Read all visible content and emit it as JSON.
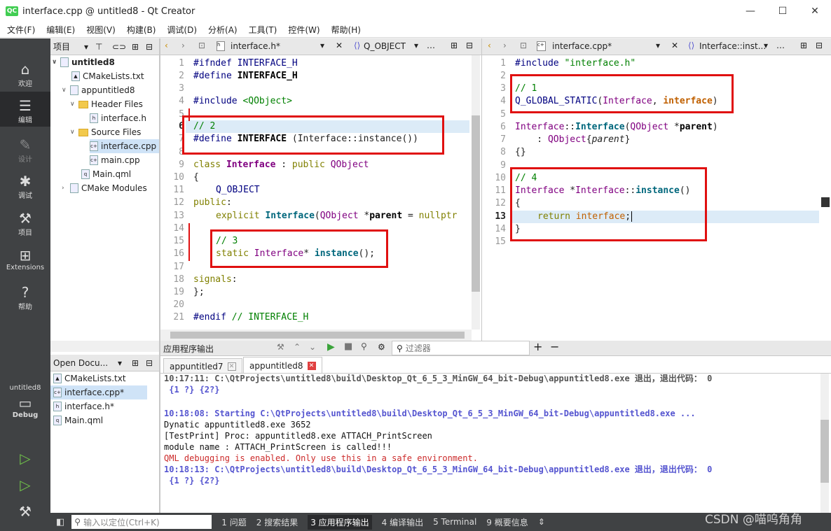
{
  "window": {
    "title": "interface.cpp @ untitled8 - Qt Creator",
    "app_icon": "QC",
    "minimize": "—",
    "maximize": "☐",
    "close": "✕"
  },
  "menu": [
    "文件(F)",
    "编辑(E)",
    "视图(V)",
    "构建(B)",
    "调试(D)",
    "分析(A)",
    "工具(T)",
    "控件(W)",
    "帮助(H)"
  ],
  "modes": [
    {
      "label": "欢迎",
      "icon": "home-icon"
    },
    {
      "label": "编辑",
      "icon": "edit-icon"
    },
    {
      "label": "设计",
      "icon": "design-icon"
    },
    {
      "label": "调试",
      "icon": "bug-icon"
    },
    {
      "label": "项目",
      "icon": "wrench-icon"
    },
    {
      "label": "Extensions",
      "icon": "extensions-icon"
    },
    {
      "label": "帮助",
      "icon": "help-icon"
    }
  ],
  "kit": {
    "project": "untitled8",
    "label": "Debug"
  },
  "project_panel": {
    "title": "项目",
    "tree": [
      "untitled8",
      "CMakeLists.txt",
      "appuntitled8",
      "Header Files",
      "interface.h",
      "Source Files",
      "interface.cpp",
      "main.cpp",
      "Main.qml",
      "CMake Modules"
    ]
  },
  "open_docs": {
    "title": "Open Docu...",
    "items": [
      "CMakeLists.txt",
      "interface.cpp*",
      "interface.h*",
      "Main.qml"
    ]
  },
  "left_editor": {
    "file": "interface.h*",
    "symbol": "Q_OBJECT",
    "lines": [
      "1",
      "2",
      "3",
      "4",
      "5",
      "6",
      "7",
      "8",
      "9",
      "10",
      "11",
      "12",
      "13",
      "14",
      "15",
      "16",
      "17",
      "18",
      "19",
      "20",
      "21"
    ]
  },
  "right_editor": {
    "file": "interface.cpp*",
    "symbol": "Interface::inst...",
    "lines": [
      "1",
      "2",
      "3",
      "4",
      "5",
      "6",
      "7",
      "8",
      "9",
      "10",
      "11",
      "12",
      "13",
      "14",
      "15"
    ]
  },
  "output": {
    "title": "应用程序输出",
    "filter_placeholder": "过滤器",
    "tabs": [
      "appuntitled7",
      "appuntitled8"
    ],
    "lines": [
      "10:17:11: C:\\QtProjects\\untitled8\\build\\Desktop_Qt_6_5_3_MinGW_64_bit-Debug\\appuntitled8.exe 退出，退出代码： 0",
      " {1 ?} {2?}",
      "",
      "10:18:08: Starting C:\\QtProjects\\untitled8\\build\\Desktop_Qt_6_5_3_MinGW_64_bit-Debug\\appuntitled8.exe ...",
      "Dynatic appuntitled8.exe 3652",
      "[TestPrint] Proc: appuntitled8.exe ATTACH_PrintScreen",
      "module name : ATTACH_PrintScreen is called!!!",
      "QML debugging is enabled. Only use this in a safe environment.",
      "10:18:13: C:\\QtProjects\\untitled8\\build\\Desktop_Qt_6_5_3_MinGW_64_bit-Debug\\appuntitled8.exe 退出，退出代码： 0",
      " {1 ?} {2?}"
    ]
  },
  "status": {
    "locator_placeholder": "输入以定位(Ctrl+K)",
    "items": [
      "1 问题",
      "2 搜索结果",
      "3 应用程序输出",
      "4 编译输出",
      "5 Terminal",
      "9 概要信息"
    ],
    "watermark": "CSDN @喵呜角角"
  },
  "colors": {
    "red_box": "#e01010",
    "sidebar": "#404244"
  }
}
